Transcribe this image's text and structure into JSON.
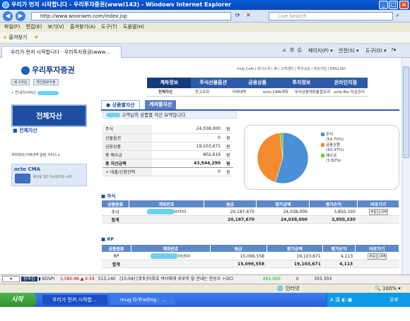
{
  "window": {
    "title": "우리가 먼저 시작합니다 - 우리투자증권(wwwi143) - Windows Internet Explorer"
  },
  "address": {
    "url": "http://www.wooriwm.com/index.jsp",
    "search_placeholder": "Live Search"
  },
  "menu": [
    "파일(F)",
    "편집(E)",
    "보기(V)",
    "즐겨찾기(A)",
    "도구(T)",
    "도움말(H)"
  ],
  "favorites": {
    "label": "즐겨찾기"
  },
  "tabs": [
    {
      "label": "우리가 먼저 시작합니다 - 우리투자증권(www..."
    }
  ],
  "toolbar_tools": [
    "페이지(P) ▾",
    "안전(S) ▾",
    "도구(O) ▾"
  ],
  "site": {
    "logo": "우리투자증권",
    "toplinks": "mug Cafe | 회사소개 | IR | 고객센터 | 투자교실 | 회원가입 | ENGLISH",
    "nav": [
      "계좌정보",
      "주식선물옵션",
      "금융상품",
      "투자정보",
      "온라인지점"
    ],
    "subnav": [
      "전체자산",
      "잔고조회",
      "거래내역",
      "octo CMA계좌",
      "우리금융계좌통합조회",
      "octo Biz 자금관리"
    ],
    "left_buttons": [
      "로그아웃",
      "개인정보수정"
    ],
    "left_crumb": "안내의서비스",
    "left_title": "전체자산",
    "left_item": "전체자산",
    "left_promo": "계좌정보/거래내역 알림 서비스 ▸",
    "octo_title": "octo CMA",
    "octo_desc": "편안을 믿은 자산관리의 시작!",
    "tab_on": "상품별자산",
    "tab_off": "계좌별자산",
    "greeting": "고객님의 상품별 자산 요약입니다."
  },
  "summary": [
    {
      "k": "주식",
      "v": "24,038,000",
      "u": "원"
    },
    {
      "k": "선물옵션",
      "v": "0",
      "u": "원"
    },
    {
      "k": "금융상품",
      "v": "19,103,671",
      "u": "원"
    },
    {
      "k": "총 예수금",
      "v": "802,619",
      "u": "원"
    },
    {
      "k": "총 자산금액",
      "v": "43,944,290",
      "u": "원"
    },
    {
      "k": "+ 대출/신용잔액",
      "v": "0",
      "u": "원"
    }
  ],
  "pie": {
    "legend": [
      {
        "label": "주식",
        "pct": "(54.70%)",
        "color": "#4a90d9",
        "value": 54.7
      },
      {
        "label": "금융상품",
        "pct": "(43.47%)",
        "color": "#f28b2e",
        "value": 43.47
      },
      {
        "label": "예수금",
        "pct": "(1.82%)",
        "color": "#7cc242",
        "value": 1.82
      }
    ]
  },
  "stock": {
    "title": "주식",
    "headers": [
      "상품종류",
      "계좌번호",
      "원금",
      "평가금액",
      "평가손익",
      "바로가기"
    ],
    "rows": [
      {
        "type": "주식",
        "acct": "(octo)",
        "principal": "20,187,670",
        "eval": "24,038,000",
        "pl": "3,850,330"
      }
    ],
    "total": {
      "label": "합계",
      "principal": "20,187,670",
      "eval": "24,038,000",
      "pl": "3,850,330"
    }
  },
  "rp": {
    "title": "RP",
    "headers": [
      "상품종류",
      "계좌번호",
      "원금",
      "평가금액",
      "평가손익",
      "바로가기"
    ],
    "rows": [
      {
        "type": "RP",
        "acct": "(octo)",
        "principal": "15,099,558",
        "eval": "19,103,671",
        "pl": "4,113"
      }
    ],
    "total": {
      "label": "합계",
      "principal": "15,099,558",
      "eval": "19,103,671",
      "pl": "4,113"
    }
  },
  "buttons": {
    "order": "주문",
    "history": "내역"
  },
  "ticker": {
    "dropdown": "장마감",
    "index": "KOSPI",
    "value": "1,580.96",
    "change": "▲ 4.59",
    "volume": "513,140",
    "news": "[15:04] [포토]이희호 여사에게 위로의 말 건내는 한승수",
    "kosdaq": "+OCI",
    "n1": "261,500",
    "n2": "0",
    "n3": "355,303"
  },
  "status": {
    "zone": "인터넷",
    "zoom": "100%"
  },
  "taskbar": {
    "start": "시작",
    "tasks": [
      "우리가 먼저 시작합...",
      "mug O-Trading : ..."
    ],
    "time": "오후 3:28"
  }
}
